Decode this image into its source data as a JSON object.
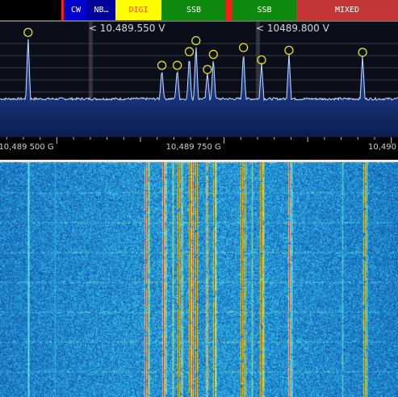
{
  "band_plan": [
    {
      "label": "",
      "bg": "#000000",
      "fg": "#ffffff"
    },
    {
      "label": "CW",
      "bg": "#0000d0",
      "fg": "#ffffff"
    },
    {
      "label": "NB…",
      "bg": "#00009c",
      "fg": "#ffffff"
    },
    {
      "label": "DIGI",
      "bg": "#ffff00",
      "fg": "#ff5a00"
    },
    {
      "label": "SSB",
      "bg": "#0e8a0e",
      "fg": "#ffffff"
    },
    {
      "label": "SSB",
      "bg": "#0e8a0e",
      "fg": "#ffffff"
    },
    {
      "label": "MIXED",
      "bg": "#c43535",
      "fg": "#ffffff"
    }
  ],
  "band_plan_colors": {
    "edge_red": "#ff1a1a",
    "divider": "#6a6a6a"
  },
  "vfo_a": {
    "label": "< 10.489.550 V",
    "frequency_khz": 10489550
  },
  "vfo_b": {
    "label": "< 10489.800 V",
    "frequency_khz": 10489800
  },
  "scale": {
    "ticks": [
      {
        "label": "10,489 500 G",
        "frequency_khz": 10489500
      },
      {
        "label": "10,489 750 G",
        "frequency_khz": 10489750
      },
      {
        "label": "10,490",
        "frequency_khz": 10490000
      }
    ],
    "span_khz": [
      10489415,
      10490010
    ]
  },
  "spectrum": {
    "peak_level_db": [
      {
        "frequency_khz": 10489457,
        "level": 0.88
      },
      {
        "frequency_khz": 10489657,
        "level": 0.4
      },
      {
        "frequency_khz": 10489680,
        "level": 0.4
      },
      {
        "frequency_khz": 10489698,
        "level": 0.6
      },
      {
        "frequency_khz": 10489708,
        "level": 0.76
      },
      {
        "frequency_khz": 10489725,
        "level": 0.34
      },
      {
        "frequency_khz": 10489734,
        "level": 0.56
      },
      {
        "frequency_khz": 10489779,
        "level": 0.66
      },
      {
        "frequency_khz": 10489806,
        "level": 0.48
      },
      {
        "frequency_khz": 10489847,
        "level": 0.62
      },
      {
        "frequency_khz": 10489957,
        "level": 0.59
      }
    ],
    "colors": {
      "background": "#0a0d1a",
      "fill_top": "#2a55b8",
      "fill_bottom": "#0b1c4f",
      "trace": "#c9dcff",
      "marker": "#f0f000",
      "grid": "#3a3a3a",
      "vfo_line": "#555555"
    }
  },
  "waterfall": {
    "colors": {
      "background": "#1c3f8f",
      "signal_high": "#d01010",
      "signal_mid": "#e8e830"
    }
  }
}
